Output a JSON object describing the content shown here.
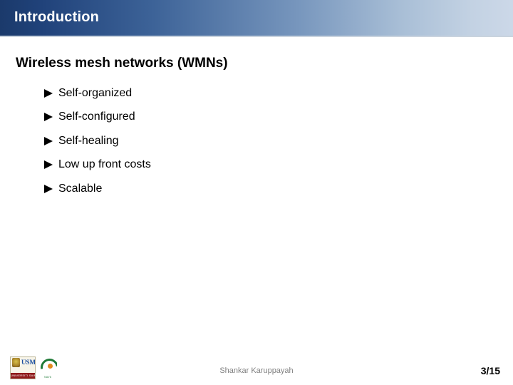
{
  "slide": {
    "title": "Introduction",
    "heading": "Wireless mesh networks (WMNs)",
    "bullets": [
      {
        "label": "Self-organized",
        "marker": "triangle-right-icon"
      },
      {
        "label": "Self-configured",
        "marker": "triangle-right-icon"
      },
      {
        "label": "Self-healing",
        "marker": "triangle-right-icon"
      },
      {
        "label": "Low up front costs",
        "marker": "triangle-right-icon"
      },
      {
        "label": "Scalable",
        "marker": "triangle-right-icon"
      }
    ],
    "footer": {
      "author": "Shankar Karuppayah",
      "page": "3/15",
      "logos": [
        {
          "name": "usm-logo",
          "text": "USM",
          "caption": "UNIVERSITI SAINS MALAYSIA"
        },
        {
          "name": "nav6-logo",
          "caption": "NAV6"
        }
      ]
    },
    "colors": {
      "title_bar_dark": "#1b3a6b",
      "title_bar_light": "#ccd8e8",
      "title_text": "#ffffff",
      "bullet_marker": "#000000",
      "footer_text": "#808080",
      "page_text": "#000000"
    }
  }
}
